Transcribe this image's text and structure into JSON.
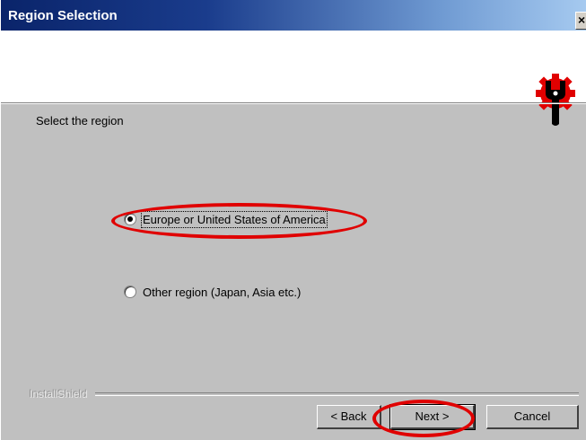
{
  "window": {
    "title": "Region Selection",
    "close_glyph": "×"
  },
  "header": {
    "logo_icon": "gear-wrench-icon",
    "logo_color": "#e00000"
  },
  "body": {
    "prompt": "Select the region",
    "options": [
      {
        "label": "Europe or United States of America",
        "selected": true
      },
      {
        "label": "Other region (Japan, Asia etc.)",
        "selected": false
      }
    ]
  },
  "footer": {
    "brand": "InstallShield",
    "back_label": "< Back",
    "next_label": "Next >",
    "cancel_label": "Cancel"
  },
  "annotation_color": "#e00000"
}
